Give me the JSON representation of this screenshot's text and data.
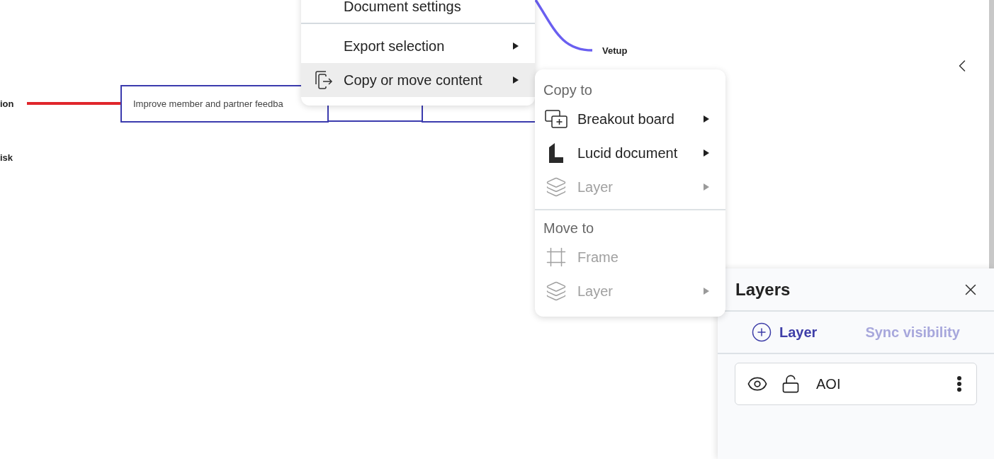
{
  "canvas": {
    "labels": [
      {
        "text": "ion"
      },
      {
        "text": "isk"
      },
      {
        "text": "Vetup"
      }
    ],
    "card": {
      "text": "Improve member and partner feedba"
    }
  },
  "context_menu": {
    "items": [
      {
        "label": "Document settings",
        "has_submenu": false,
        "selected": false,
        "kind": "plain",
        "divider_after": true
      },
      {
        "label": "Export selection",
        "has_submenu": true,
        "selected": false,
        "kind": "plain",
        "divider_after": false
      },
      {
        "label": "Copy or move content",
        "has_submenu": true,
        "selected": true,
        "kind": "copy",
        "divider_after": false
      }
    ]
  },
  "submenu": {
    "sections": [
      {
        "heading": "Copy to",
        "items": [
          {
            "label": "Breakout board",
            "kind": "board",
            "disabled": false,
            "has_submenu": true
          },
          {
            "label": "Lucid document",
            "kind": "document",
            "disabled": false,
            "has_submenu": true
          },
          {
            "label": "Layer",
            "kind": "layer",
            "disabled": true,
            "has_submenu": true
          }
        ]
      },
      {
        "heading": "Move to",
        "items": [
          {
            "label": "Frame",
            "kind": "frame",
            "disabled": true,
            "has_submenu": false
          },
          {
            "label": "Layer",
            "kind": "layer",
            "disabled": true,
            "has_submenu": true
          }
        ]
      }
    ]
  },
  "layers_panel": {
    "title": "Layers",
    "add_button": "Layer",
    "sync_button": {
      "label": "Sync visibility",
      "disabled": true
    },
    "layers": [
      {
        "name": "AOI",
        "visible": true,
        "locked": false
      }
    ]
  }
}
